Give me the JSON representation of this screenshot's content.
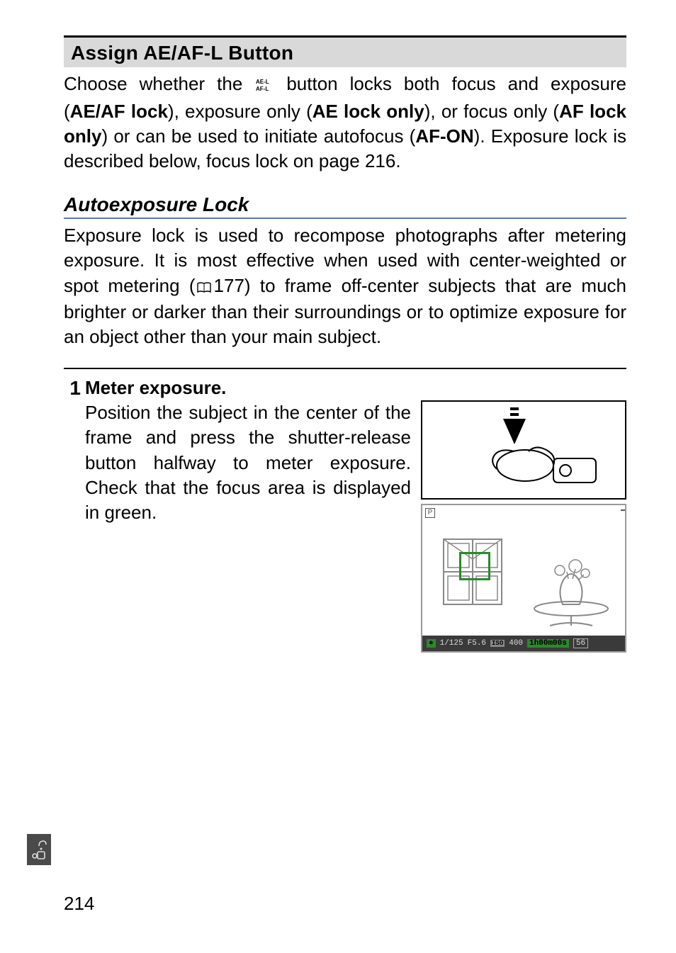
{
  "section_title": "Assign AE/AF-L Button",
  "intro": {
    "t1": "Choose whether the ",
    "t2": " button locks both focus and exposure (",
    "b1": "AE/AF lock",
    "t3": "), exposure only (",
    "b2": "AE lock only",
    "t4": "), or focus only (",
    "b3": "AF lock only",
    "t5": ") or can be used to initiate autofocus (",
    "b4": "AF-ON",
    "t6": "). Exposure lock is described below, focus lock on page 216."
  },
  "sub_title": "Autoexposure Lock",
  "sub_para": {
    "t1": "Exposure lock is used to recompose photographs after metering exposure. It is most effective when used with center-weighted or spot metering (",
    "ref": "177",
    "t2": ") to frame off-center subjects that are much brighter or darker than their surroundings or to optimize exposure for an object other than your main subject."
  },
  "step": {
    "num": "1",
    "title": "Meter exposure.",
    "text": "Position the subject in the center of the frame and press the shutter-release button halfway to meter exposure. Check that the focus area is displayed in green."
  },
  "status": {
    "focus": "●",
    "shutter": "1/125",
    "aperture": "F5.6",
    "iso_label": "ISO",
    "iso": "400",
    "time": "1h00m00s",
    "remaining": "56"
  },
  "fig2_p": "P",
  "page_number": "214"
}
